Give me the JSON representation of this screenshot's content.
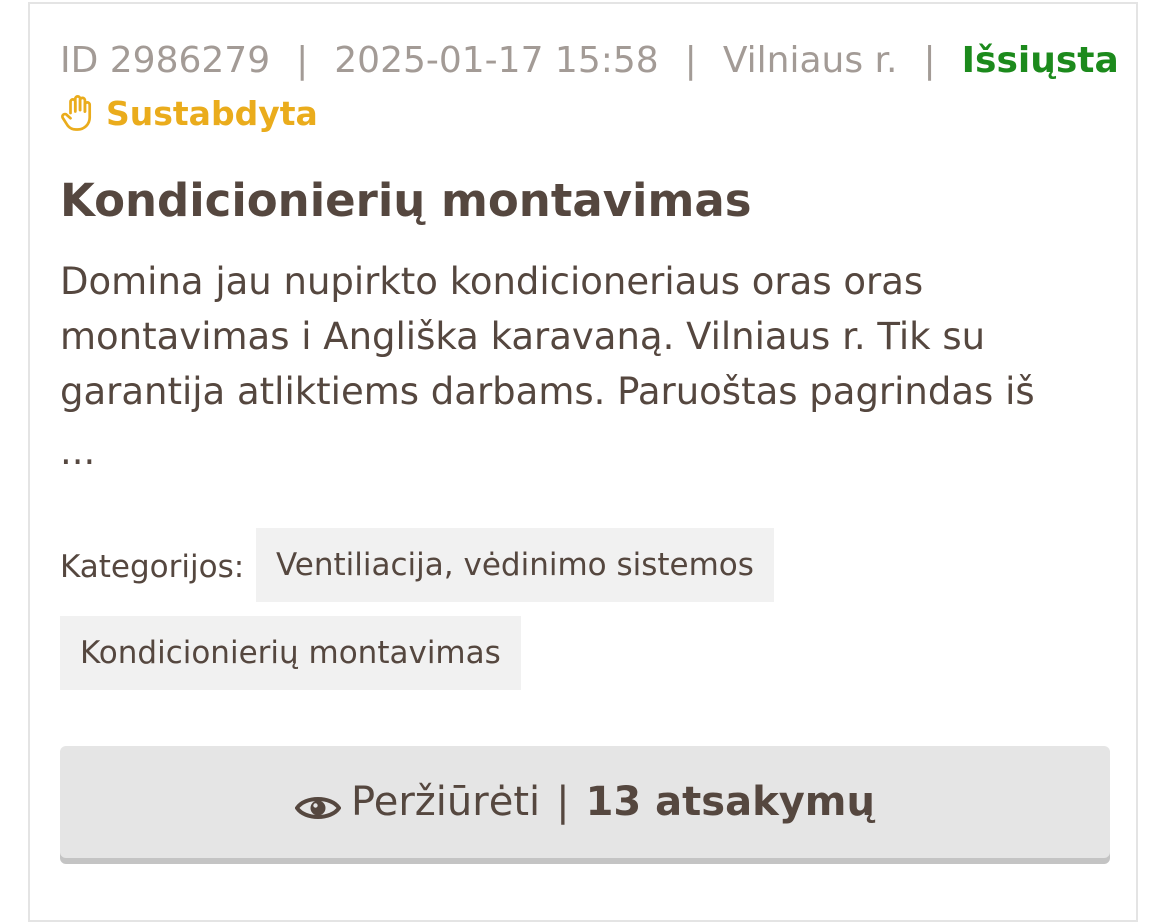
{
  "job": {
    "id_label": "ID 2986279",
    "datetime": "2025-01-17 15:58",
    "location": "Vilniaus r.",
    "separator": "|",
    "status_sent": "Išsiųsta",
    "status_paused": "Sustabdyta",
    "title": "Kondicionierių montavimas",
    "description": "Domina jau nupirkto kondicioneriaus oras oras montavimas i Angliška karavaną. Vilniaus r. Tik su garantija atliktiems darbams. Paruoštas pagrindas iš",
    "ellipsis": "..."
  },
  "categories": {
    "label": "Kategorijos:",
    "tags": [
      "Ventiliacija, vėdinimo sistemos",
      "Kondicionierių montavimas"
    ]
  },
  "view_button": {
    "label": "Peržiūrėti",
    "separator": "|",
    "responses": "13 atsakymų"
  },
  "colors": {
    "status_sent": "#1c8a1c",
    "status_paused": "#eaac1c",
    "text_main": "#55473f",
    "text_meta": "#a39b96"
  },
  "icons": {
    "paused": "hand-stop-icon",
    "view": "eye-icon"
  }
}
